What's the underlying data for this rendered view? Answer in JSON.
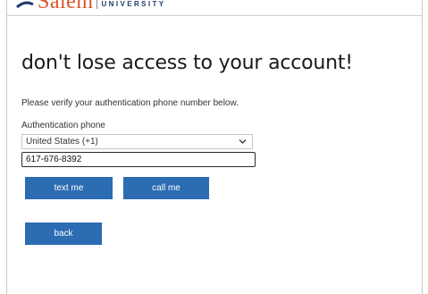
{
  "brand": {
    "name": "Salem",
    "sub": "UNIVERSITY",
    "colors": {
      "name": "#d9532b",
      "sub": "#1f3c6d"
    }
  },
  "page": {
    "heading": "don't lose access to your account!",
    "instruction": "Please verify your authentication phone number below."
  },
  "form": {
    "phone_label": "Authentication phone",
    "country_selected": "United States (+1)",
    "phone_value": "617-676-8392"
  },
  "buttons": {
    "text_me": "text me",
    "call_me": "call me",
    "back": "back",
    "color": "#2b6cb3"
  },
  "icons": {
    "country_dropdown": "chevron-down-icon"
  }
}
